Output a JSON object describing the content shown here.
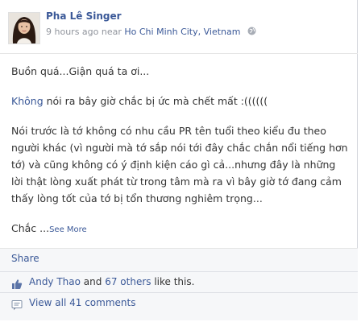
{
  "post": {
    "author": "Pha Lê Singer",
    "time": "9 hours ago near",
    "location": "Ho Chi Minh City, Vietnam",
    "line1": "Buồn quá...Giận quá ta ơi...",
    "line2_link": "Không",
    "line2_rest": " nói ra bây giờ chắc bị ức mà chết mất :((((((",
    "para3": "Nói trước là tớ không có nhu cầu PR tên tuổi theo kiểu đu theo người khác (vì người mà tớ sắp nói tới đây chắc chắn nổi tiếng hơn tớ) và cũng không có ý định kiện cáo gì cả...nhưng đây là những lời thật lòng xuất phát từ trong tâm mà ra vì bây giờ tớ đang cảm thấy lòng tốt của tớ bị tổn thương nghiêm trọng...",
    "line4": "Chắc ...",
    "see_more": "See More"
  },
  "actions": {
    "share": "Share"
  },
  "likes": {
    "user": "Andy Thao",
    "and": " and ",
    "others": "67 others",
    "suffix": " like this."
  },
  "comments": {
    "label": "View all 41 comments"
  },
  "icons": {
    "globe": "globe-icon",
    "like": "thumbs-up-icon",
    "comment": "comment-icon"
  },
  "colors": {
    "link": "#3b5998",
    "meta": "#90949c",
    "footer_bg": "#f6f7f9"
  }
}
